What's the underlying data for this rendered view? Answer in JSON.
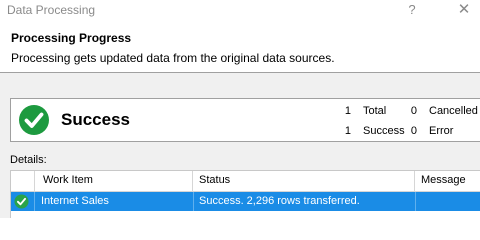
{
  "window": {
    "title": "Data Processing",
    "help_glyph": "?",
    "close_glyph": "✕"
  },
  "header": {
    "title": "Processing Progress",
    "description": "Processing gets updated data from the original data sources."
  },
  "status": {
    "label": "Success",
    "icon": "check-circle-icon",
    "color": "#1d9a3f",
    "total_count": "1",
    "total_label": "Total",
    "success_count": "1",
    "success_label": "Success",
    "cancelled_count": "0",
    "cancelled_label": "Cancelled",
    "error_count": "0",
    "error_label": "Error"
  },
  "details": {
    "label": "Details:",
    "columns": [
      "Work Item",
      "Status",
      "Message"
    ],
    "rows": [
      {
        "icon": "check-circle-icon",
        "work_item": "Internet Sales",
        "status": "Success. 2,296 rows transferred.",
        "message": ""
      }
    ]
  },
  "colors": {
    "selection": "#1a8ce6",
    "panel_background": "#f0f0f0"
  }
}
